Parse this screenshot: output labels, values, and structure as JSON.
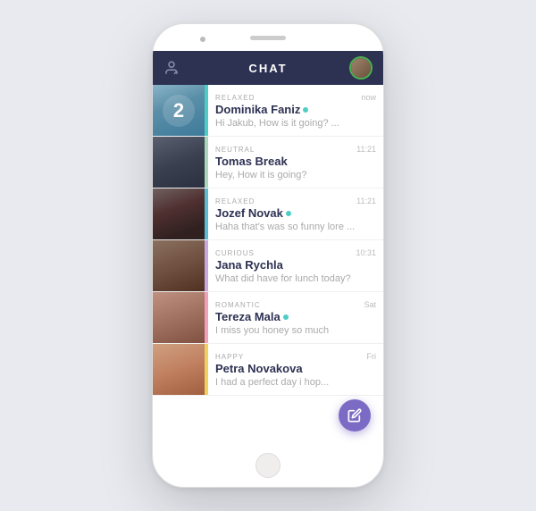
{
  "header": {
    "title": "CHAT",
    "left_icon": "contacts-icon",
    "right_avatar": "user-avatar"
  },
  "chats": [
    {
      "id": 1,
      "mood": "RELAXED",
      "mood_color": "mood-green",
      "photo_class": "photo-1",
      "name": "Dominika Faniz",
      "online": true,
      "time": "now",
      "preview": "Hi Jakub, How is it going? ...",
      "unread": "2"
    },
    {
      "id": 2,
      "mood": "NEUTRAL",
      "mood_color": "mood-teal",
      "photo_class": "photo-2",
      "name": "Tomas Break",
      "online": false,
      "time": "11:21",
      "preview": "Hey, How it is going?",
      "unread": ""
    },
    {
      "id": 3,
      "mood": "RELAXED",
      "mood_color": "mood-cyan",
      "photo_class": "photo-3",
      "name": "Jozef Novak",
      "online": true,
      "time": "11:21",
      "preview": "Haha that's was so funny lore ...",
      "unread": ""
    },
    {
      "id": 4,
      "mood": "CURIOUS",
      "mood_color": "mood-purple",
      "photo_class": "photo-4",
      "name": "Jana Rychla",
      "online": false,
      "time": "10:31",
      "preview": "What did have for lunch today?",
      "unread": ""
    },
    {
      "id": 5,
      "mood": "ROMANTIC",
      "mood_color": "mood-pink",
      "photo_class": "photo-5",
      "name": "Tereza Mala",
      "online": true,
      "time": "Sat",
      "preview": "I miss you honey so much",
      "unread": ""
    },
    {
      "id": 6,
      "mood": "HAPPY",
      "mood_color": "mood-yellow",
      "photo_class": "photo-6",
      "name": "Petra Novakova",
      "online": false,
      "time": "Fri",
      "preview": "I had a perfect day i hop...",
      "unread": ""
    }
  ],
  "fab": {
    "label": "compose-button",
    "icon": "compose-icon"
  }
}
